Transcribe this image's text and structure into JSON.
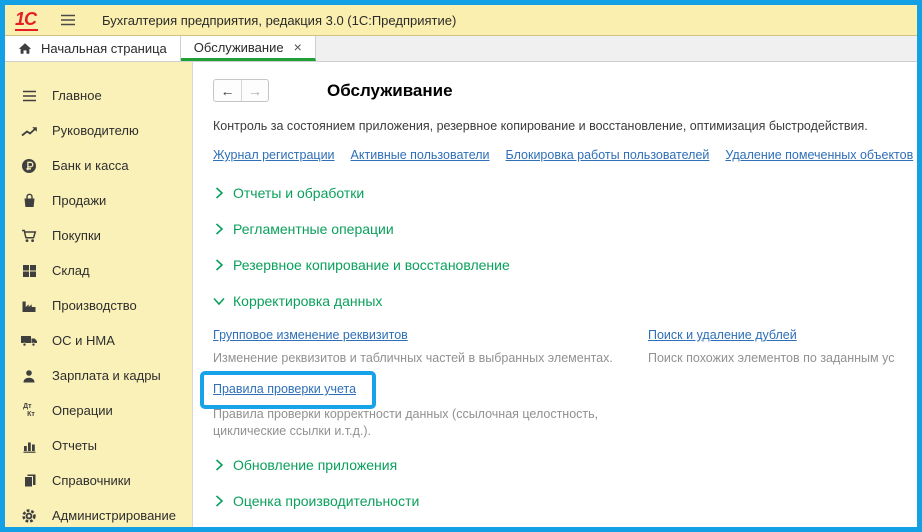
{
  "titlebar": {
    "logo_text": "1С",
    "app_title": "Бухгалтерия предприятия, редакция 3.0  (1С:Предприятие)"
  },
  "tabs": {
    "home_tab": "Начальная страница",
    "active_tab": "Обслуживание",
    "close_glyph": "×"
  },
  "sidebar": {
    "items": [
      {
        "label": "Главное",
        "icon": "menu-icon"
      },
      {
        "label": "Руководителю",
        "icon": "trend-icon"
      },
      {
        "label": "Банк и касса",
        "icon": "ruble-icon"
      },
      {
        "label": "Продажи",
        "icon": "bag-icon"
      },
      {
        "label": "Покупки",
        "icon": "cart-icon"
      },
      {
        "label": "Склад",
        "icon": "warehouse-icon"
      },
      {
        "label": "Производство",
        "icon": "factory-icon"
      },
      {
        "label": "ОС и НМА",
        "icon": "truck-icon"
      },
      {
        "label": "Зарплата и кадры",
        "icon": "person-icon"
      },
      {
        "label": "Операции",
        "icon": "dtkt-icon",
        "icon_text_top": "Дт",
        "icon_text_bottom": "Кт"
      },
      {
        "label": "Отчеты",
        "icon": "barchart-icon"
      },
      {
        "label": "Справочники",
        "icon": "books-icon"
      },
      {
        "label": "Администрирование",
        "icon": "gear-icon"
      }
    ]
  },
  "main": {
    "nav": {
      "back": "←",
      "forward": "→"
    },
    "page_title": "Обслуживание",
    "description": "Контроль за состоянием приложения, резервное копирование и восстановление, оптимизация быстродействия.",
    "top_links": [
      "Журнал регистрации",
      "Активные пользователи",
      "Блокировка работы пользователей",
      "Удаление помеченных объектов"
    ],
    "sections": [
      {
        "label": "Отчеты и обработки",
        "expanded": false
      },
      {
        "label": "Регламентные операции",
        "expanded": false
      },
      {
        "label": "Резервное копирование и восстановление",
        "expanded": false
      },
      {
        "label": "Корректировка данных",
        "expanded": true
      },
      {
        "label": "Обновление приложения",
        "expanded": false
      },
      {
        "label": "Оценка производительности",
        "expanded": false
      }
    ],
    "data_correction": {
      "group_change_link": "Групповое изменение реквизитов",
      "group_change_desc": "Изменение реквизитов и табличных частей в выбранных элементах.",
      "rules_link": "Правила проверки учета",
      "rules_desc": "Правила проверки корректности данных (ссылочная целостность, циклические ссылки и.т.д.).",
      "duplicates_link": "Поиск и удаление дублей",
      "duplicates_desc": "Поиск похожих элементов по заданным ус"
    }
  },
  "colors": {
    "window_border": "#14a0e4",
    "titlebar_bg": "#faefae",
    "sidebar_bg": "#faf1b8",
    "active_tab_underline": "#21a038",
    "section_green": "#0aa05c",
    "link_blue": "#2e6fb7",
    "highlight_blue": "#18a2e9",
    "logo_red": "#e31e24",
    "desc_gray": "#919191"
  }
}
